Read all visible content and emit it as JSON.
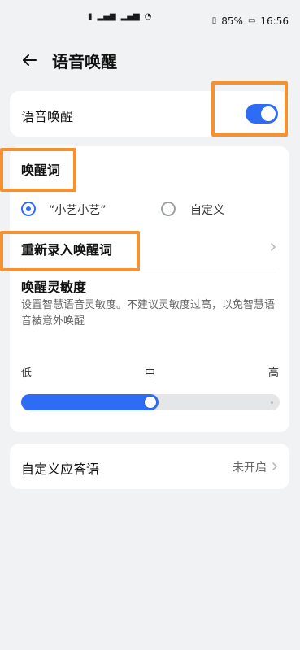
{
  "status_bar": {
    "battery": "85%",
    "time": "16:56",
    "icons": [
      "hd-icon",
      "signal-icon",
      "signal-icon",
      "wifi-icon",
      "vibrate-icon",
      "battery-icon"
    ]
  },
  "header": {
    "title": "语音唤醒",
    "back_icon": "arrow-left-icon"
  },
  "wake_card": {
    "label": "语音唤醒",
    "enabled": true
  },
  "wake_word": {
    "title": "唤醒词",
    "options": [
      {
        "label": "“小艺小艺”",
        "selected": true
      },
      {
        "label": "自定义",
        "selected": false
      }
    ],
    "record_label": "重新录入唤醒词"
  },
  "sensitivity": {
    "title": "唤醒灵敏度",
    "description": "设置智慧语音灵敏度。不建议灵敏度过高，以免智慧语音被意外唤醒",
    "ticks": [
      "低",
      "中",
      "高"
    ],
    "value_fraction": 0.5
  },
  "custom_reply": {
    "label": "自定义应答语",
    "status": "未开启"
  },
  "colors": {
    "accent": "#2f6cf6",
    "highlight": "#f5922f",
    "background": "#f1f2f4"
  }
}
